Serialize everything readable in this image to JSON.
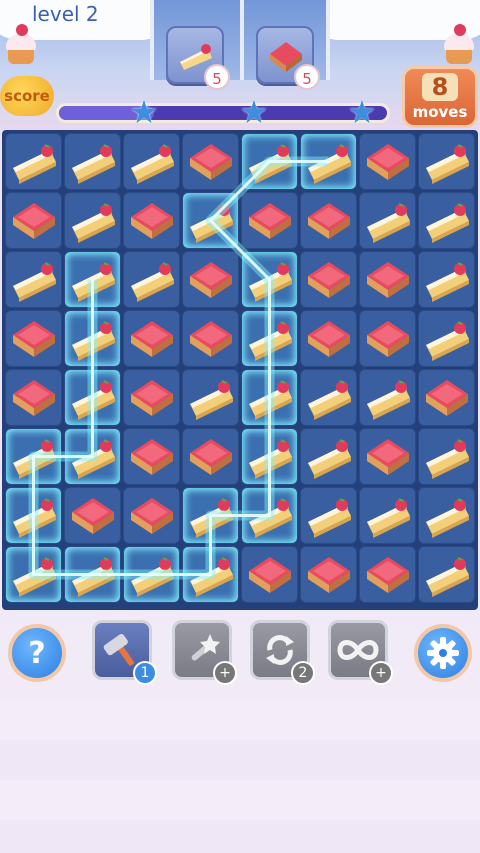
{
  "header": {
    "level_text": "level 2",
    "score_label": "score",
    "moves_value": "8",
    "moves_label": "moves",
    "score_progress": 0.29
  },
  "goals": [
    {
      "item": "cheesecake-slice",
      "count": "5"
    },
    {
      "item": "red-jelly-cake",
      "count": "5"
    }
  ],
  "board": {
    "rows": 8,
    "cols": 8,
    "grid": [
      [
        "C",
        "C",
        "C",
        "R",
        "C",
        "C",
        "R",
        "C"
      ],
      [
        "R",
        "C",
        "R",
        "C",
        "R",
        "R",
        "C",
        "C"
      ],
      [
        "C",
        "C",
        "C",
        "R",
        "C",
        "R",
        "R",
        "C"
      ],
      [
        "R",
        "C",
        "R",
        "R",
        "C",
        "R",
        "R",
        "C"
      ],
      [
        "R",
        "C",
        "R",
        "C",
        "C",
        "C",
        "C",
        "R"
      ],
      [
        "C",
        "C",
        "R",
        "R",
        "C",
        "C",
        "R",
        "C"
      ],
      [
        "C",
        "R",
        "R",
        "C",
        "C",
        "C",
        "C",
        "C"
      ],
      [
        "C",
        "C",
        "C",
        "C",
        "R",
        "R",
        "R",
        "C"
      ]
    ],
    "selected_path": [
      [
        0,
        5
      ],
      [
        0,
        4
      ],
      [
        1,
        3
      ],
      [
        2,
        4
      ],
      [
        3,
        4
      ],
      [
        4,
        4
      ],
      [
        5,
        4
      ],
      [
        6,
        4
      ],
      [
        6,
        3
      ],
      [
        7,
        3
      ],
      [
        7,
        2
      ],
      [
        7,
        1
      ],
      [
        7,
        0
      ],
      [
        6,
        0
      ],
      [
        5,
        0
      ],
      [
        5,
        1
      ],
      [
        4,
        1
      ],
      [
        3,
        1
      ],
      [
        2,
        1
      ]
    ]
  },
  "boosters": [
    {
      "name": "hammer",
      "count": "1"
    },
    {
      "name": "magic-wand",
      "count": "+"
    },
    {
      "name": "shuffle",
      "count": "2"
    },
    {
      "name": "infinity",
      "count": "+"
    }
  ],
  "buttons": {
    "help_glyph": "?",
    "settings_icon": "gear-icon"
  },
  "colors": {
    "board_bg": "#24407a",
    "cell_bg": "#3a5fa0",
    "path_glow": "#7ff2ff",
    "moves_box": "#e8743f",
    "accent_blue": "#3b8ee0"
  }
}
